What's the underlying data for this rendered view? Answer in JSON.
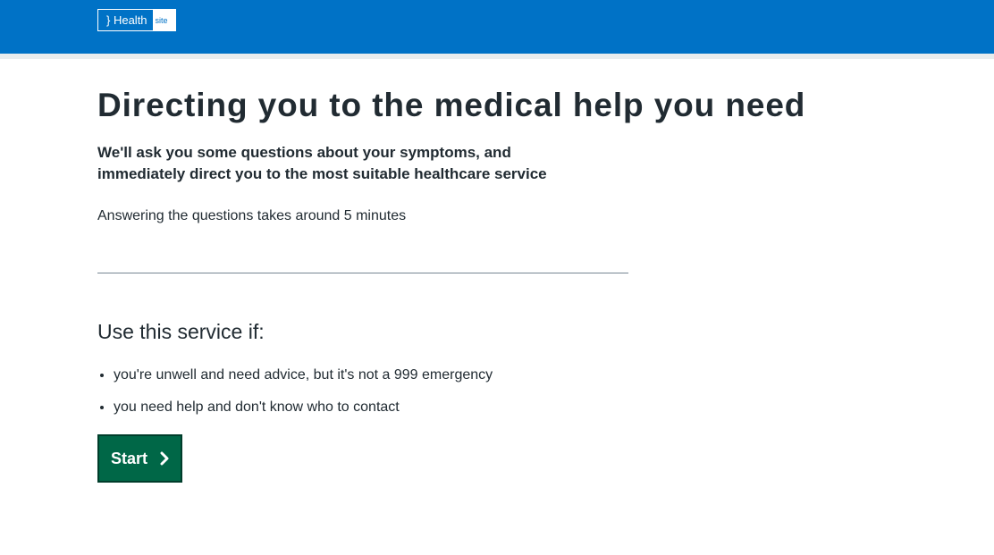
{
  "header": {
    "logo_main": "} Health",
    "logo_suffix": "site",
    "bg_color": "#0072c6"
  },
  "main": {
    "title": "Directing you to the medical help you need",
    "lede": "We'll ask you some questions about your symptoms, and immediately direct you to the most suitable healthcare service",
    "time_note": "Answering the questions takes around 5 minutes",
    "use_heading": "Use this service if:",
    "use_items": [
      "you're unwell and need advice, but it's not a 999 emergency",
      "you need help and don't know who to contact"
    ],
    "start_label": "Start",
    "start_icon": "chevron-right-icon",
    "start_color": "#006747"
  }
}
